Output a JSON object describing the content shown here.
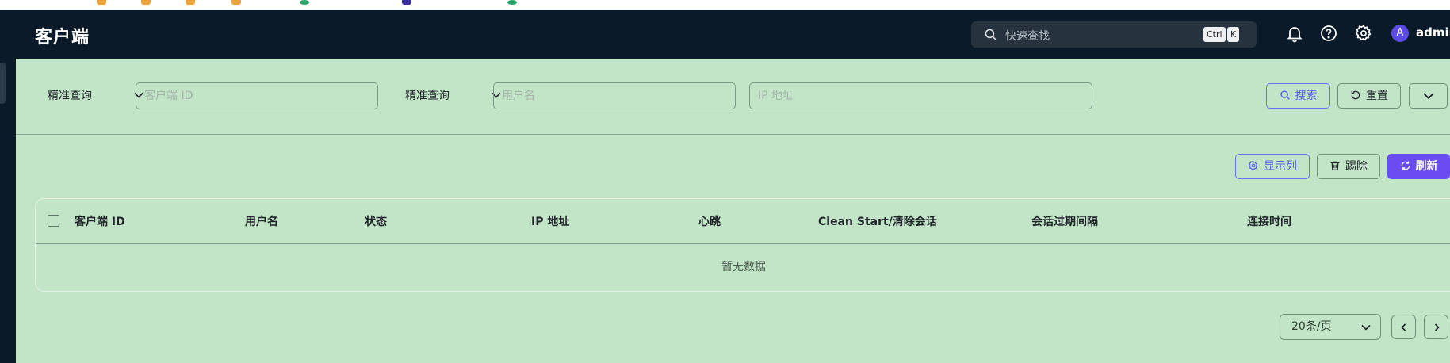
{
  "browser": {
    "bookmark_colors": [
      "#e8a33a",
      "#e8a33a",
      "#e8a33a",
      "#e8a33a",
      "#2aa56a",
      "#3b2f9a",
      "#2aa56a"
    ]
  },
  "topbar": {
    "title": "客户端",
    "search_placeholder": "快速查找",
    "shortcut_ctrl": "Ctrl",
    "shortcut_k": "K",
    "icons": [
      "bell-icon",
      "help-icon",
      "gear-icon"
    ],
    "avatar_letter": "A",
    "username": "admin"
  },
  "filters": {
    "mode1": "精准查询",
    "field1_placeholder": "客户端 ID",
    "mode2": "精准查询",
    "field2_placeholder": "用户名",
    "field3_placeholder": "IP 地址",
    "search_label": "搜索",
    "reset_label": "重置"
  },
  "toolbar": {
    "columns_label": "显示列",
    "kick_label": "踢除",
    "refresh_label": "刷新"
  },
  "table": {
    "columns": [
      "客户端 ID",
      "用户名",
      "状态",
      "IP 地址",
      "心跳",
      "Clean Start/清除会话",
      "会话过期间隔",
      "连接时间"
    ],
    "empty_text": "暂无数据"
  },
  "pagination": {
    "page_size": "20条/页"
  },
  "colors": {
    "topbar_bg": "#0b1a28",
    "content_bg": "#c1e5c6",
    "accent": "#6a4cf1",
    "outline_accent": "#6676e6"
  }
}
